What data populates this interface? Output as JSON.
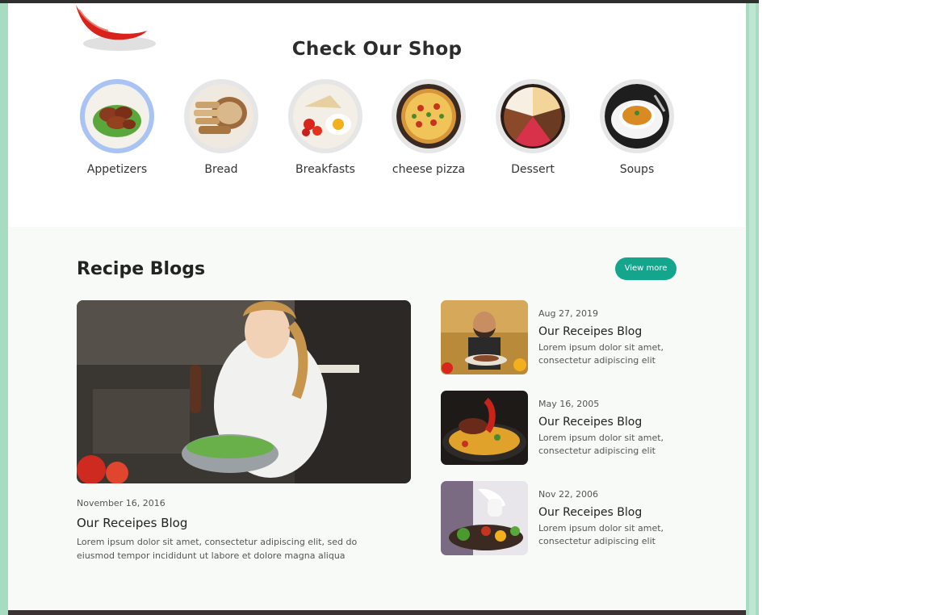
{
  "shop": {
    "title": "Check Our Shop",
    "categories": [
      {
        "label": "Appetizers",
        "icon": "appetizers-plate-icon",
        "active": true
      },
      {
        "label": "Bread",
        "icon": "bread-icon",
        "active": false
      },
      {
        "label": "Breakfasts",
        "icon": "breakfast-plate-icon",
        "active": false
      },
      {
        "label": "cheese pizza",
        "icon": "pizza-icon",
        "active": false
      },
      {
        "label": "Dessert",
        "icon": "cake-icon",
        "active": false
      },
      {
        "label": "Soups",
        "icon": "soup-bowl-icon",
        "active": false
      }
    ]
  },
  "blogs": {
    "title": "Recipe Blogs",
    "view_more_label": "View more",
    "featured": {
      "date": "November 16, 2016",
      "title": "Our Receipes Blog",
      "text": "Lorem ipsum dolor sit amet, consectetur adipiscing elit, sed do eiusmod tempor incididunt ut labore et dolore magna aliqua"
    },
    "posts": [
      {
        "date": "Aug 27, 2019",
        "title": "Our Receipes Blog",
        "text": "Lorem ipsum dolor sit amet, consectetur adipiscing elit"
      },
      {
        "date": "May 16, 2005",
        "title": "Our Receipes Blog",
        "text": "Lorem ipsum dolor sit amet, consectetur adipiscing elit"
      },
      {
        "date": "Nov 22, 2006",
        "title": "Our Receipes Blog",
        "text": "Lorem ipsum dolor sit amet, consectetur adipiscing elit"
      }
    ]
  },
  "colors": {
    "accent": "#14a58d",
    "frame": "#a7dcc2",
    "active_ring": "#a9c3f5",
    "section_bg": "#f7faf6"
  }
}
